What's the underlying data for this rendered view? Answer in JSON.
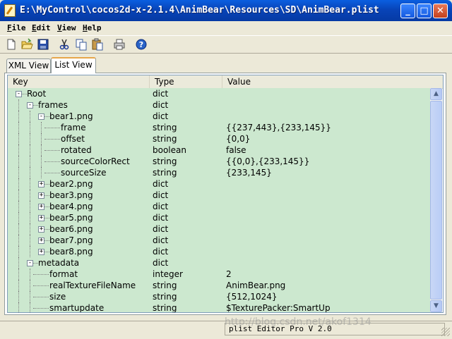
{
  "window": {
    "title": "E:\\MyControl\\cocos2d-x-2.1.4\\AnimBear\\Resources\\SD\\AnimBear.plist",
    "min_glyph": "_",
    "max_glyph": "□",
    "close_glyph": "✕"
  },
  "menu": [
    "File",
    "Edit",
    "View",
    "Help"
  ],
  "toolbar": {
    "icons": [
      "new-icon",
      "open-icon",
      "save-icon",
      "cut-icon",
      "copy-icon",
      "paste-icon",
      "print-icon",
      "help-icon"
    ]
  },
  "tabs": {
    "xml": "XML View",
    "list": "List View",
    "active": "List View"
  },
  "columns": {
    "key": "Key",
    "type": "Type",
    "value": "Value"
  },
  "rows": [
    {
      "key": "Root",
      "type": "dict",
      "value": "",
      "level": 0,
      "expander": "-"
    },
    {
      "key": "frames",
      "type": "dict",
      "value": "",
      "level": 1,
      "expander": "-"
    },
    {
      "key": "bear1.png",
      "type": "dict",
      "value": "",
      "level": 2,
      "expander": "-"
    },
    {
      "key": "frame",
      "type": "string",
      "value": "{{237,443},{233,145}}",
      "level": 3,
      "expander": ""
    },
    {
      "key": "offset",
      "type": "string",
      "value": "{0,0}",
      "level": 3,
      "expander": ""
    },
    {
      "key": "rotated",
      "type": "boolean",
      "value": "false",
      "level": 3,
      "expander": ""
    },
    {
      "key": "sourceColorRect",
      "type": "string",
      "value": "{{0,0},{233,145}}",
      "level": 3,
      "expander": ""
    },
    {
      "key": "sourceSize",
      "type": "string",
      "value": "{233,145}",
      "level": 3,
      "expander": ""
    },
    {
      "key": "bear2.png",
      "type": "dict",
      "value": "",
      "level": 2,
      "expander": "+"
    },
    {
      "key": "bear3.png",
      "type": "dict",
      "value": "",
      "level": 2,
      "expander": "+"
    },
    {
      "key": "bear4.png",
      "type": "dict",
      "value": "",
      "level": 2,
      "expander": "+"
    },
    {
      "key": "bear5.png",
      "type": "dict",
      "value": "",
      "level": 2,
      "expander": "+"
    },
    {
      "key": "bear6.png",
      "type": "dict",
      "value": "",
      "level": 2,
      "expander": "+"
    },
    {
      "key": "bear7.png",
      "type": "dict",
      "value": "",
      "level": 2,
      "expander": "+"
    },
    {
      "key": "bear8.png",
      "type": "dict",
      "value": "",
      "level": 2,
      "expander": "+"
    },
    {
      "key": "metadata",
      "type": "dict",
      "value": "",
      "level": 1,
      "expander": "-"
    },
    {
      "key": "format",
      "type": "integer",
      "value": "2",
      "level": 2,
      "expander": ""
    },
    {
      "key": "realTextureFileName",
      "type": "string",
      "value": "AnimBear.png",
      "level": 2,
      "expander": ""
    },
    {
      "key": "size",
      "type": "string",
      "value": "{512,1024}",
      "level": 2,
      "expander": ""
    },
    {
      "key": "smartupdate",
      "type": "string",
      "value": "$TexturePacker:SmartUp",
      "level": 2,
      "expander": ""
    }
  ],
  "scrollbar": {
    "up_glyph": "▲",
    "down_glyph": "▼"
  },
  "status": {
    "text": "plist Editor Pro V 2.0",
    "watermark": "http://blog.csdn.net/akof1314"
  },
  "colors": {
    "list_background": "#cce8cf",
    "titlebar": "#0a5fe0",
    "active_tab_accent": "#e7a64a"
  }
}
